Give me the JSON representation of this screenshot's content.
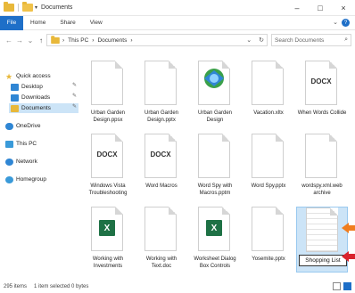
{
  "window": {
    "title": "Documents",
    "minimize": "–",
    "maximize": "□",
    "close": "×"
  },
  "ribbon": {
    "tabs": [
      "File",
      "Home",
      "Share",
      "View"
    ],
    "expand": "⌄",
    "help": "?"
  },
  "address": {
    "back": "←",
    "forward": "→",
    "up_history": "⌄",
    "up": "↑",
    "crumbs": [
      "This PC",
      "Documents"
    ],
    "separator": "›",
    "dropdown": "⌄",
    "refresh": "↻"
  },
  "search": {
    "placeholder": "Search Documents",
    "icon": "search-icon"
  },
  "nav": {
    "quick_access": "Quick access",
    "items": [
      {
        "label": "Desktop",
        "pinned": true
      },
      {
        "label": "Downloads",
        "pinned": true
      },
      {
        "label": "Documents",
        "pinned": true,
        "selected": true
      }
    ],
    "onedrive": "OneDrive",
    "this_pc": "This PC",
    "network": "Network",
    "homegroup": "Homegroup"
  },
  "files": [
    {
      "name": "Urban Garden Design.ppsx",
      "type": "blank"
    },
    {
      "name": "Urban Garden Design.pptx",
      "type": "blank"
    },
    {
      "name": "Urban Garden Design",
      "type": "globe"
    },
    {
      "name": "Vacation.xltx",
      "type": "blank"
    },
    {
      "name": "When Words Collide",
      "type": "docx"
    },
    {
      "name": "Windows Vista Troubleshooting",
      "type": "docx"
    },
    {
      "name": "Word Macros",
      "type": "docx"
    },
    {
      "name": "Word Spy with Macros.pptm",
      "type": "blank"
    },
    {
      "name": "Word Spy.pptx",
      "type": "blank"
    },
    {
      "name": "wordspy.xml.web archive",
      "type": "blank"
    },
    {
      "name": "Working with Investments",
      "type": "excel"
    },
    {
      "name": "Working with Text.doc",
      "type": "blank"
    },
    {
      "name": "Worksheet Dialog Box Controls",
      "type": "excel"
    },
    {
      "name": "Yosemite.pptx",
      "type": "blank"
    },
    {
      "name": "Shopping List",
      "type": "selected-rename"
    }
  ],
  "docx_label": "DOCX",
  "excel_letter": "X",
  "status": {
    "items": "295 items",
    "selected": "1 item selected  0 bytes"
  },
  "colors": {
    "accent": "#1e6fc8",
    "folder": "#e8b83a",
    "excel": "#1e7145",
    "selection": "#cce4f7",
    "callout_orange": "#f07d1e",
    "callout_red": "#d9232d"
  }
}
